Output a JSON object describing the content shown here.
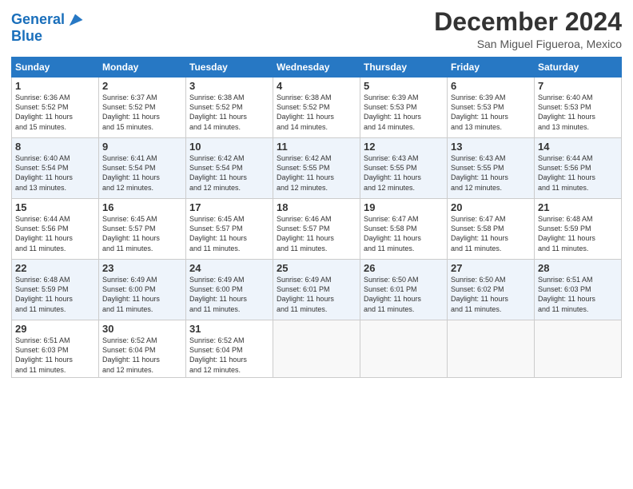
{
  "header": {
    "logo_line1": "General",
    "logo_line2": "Blue",
    "month": "December 2024",
    "location": "San Miguel Figueroa, Mexico"
  },
  "days_of_week": [
    "Sunday",
    "Monday",
    "Tuesday",
    "Wednesday",
    "Thursday",
    "Friday",
    "Saturday"
  ],
  "weeks": [
    [
      {
        "num": "1",
        "lines": [
          "Sunrise: 6:36 AM",
          "Sunset: 5:52 PM",
          "Daylight: 11 hours",
          "and 15 minutes."
        ]
      },
      {
        "num": "2",
        "lines": [
          "Sunrise: 6:37 AM",
          "Sunset: 5:52 PM",
          "Daylight: 11 hours",
          "and 15 minutes."
        ]
      },
      {
        "num": "3",
        "lines": [
          "Sunrise: 6:38 AM",
          "Sunset: 5:52 PM",
          "Daylight: 11 hours",
          "and 14 minutes."
        ]
      },
      {
        "num": "4",
        "lines": [
          "Sunrise: 6:38 AM",
          "Sunset: 5:52 PM",
          "Daylight: 11 hours",
          "and 14 minutes."
        ]
      },
      {
        "num": "5",
        "lines": [
          "Sunrise: 6:39 AM",
          "Sunset: 5:53 PM",
          "Daylight: 11 hours",
          "and 14 minutes."
        ]
      },
      {
        "num": "6",
        "lines": [
          "Sunrise: 6:39 AM",
          "Sunset: 5:53 PM",
          "Daylight: 11 hours",
          "and 13 minutes."
        ]
      },
      {
        "num": "7",
        "lines": [
          "Sunrise: 6:40 AM",
          "Sunset: 5:53 PM",
          "Daylight: 11 hours",
          "and 13 minutes."
        ]
      }
    ],
    [
      {
        "num": "8",
        "lines": [
          "Sunrise: 6:40 AM",
          "Sunset: 5:54 PM",
          "Daylight: 11 hours",
          "and 13 minutes."
        ]
      },
      {
        "num": "9",
        "lines": [
          "Sunrise: 6:41 AM",
          "Sunset: 5:54 PM",
          "Daylight: 11 hours",
          "and 12 minutes."
        ]
      },
      {
        "num": "10",
        "lines": [
          "Sunrise: 6:42 AM",
          "Sunset: 5:54 PM",
          "Daylight: 11 hours",
          "and 12 minutes."
        ]
      },
      {
        "num": "11",
        "lines": [
          "Sunrise: 6:42 AM",
          "Sunset: 5:55 PM",
          "Daylight: 11 hours",
          "and 12 minutes."
        ]
      },
      {
        "num": "12",
        "lines": [
          "Sunrise: 6:43 AM",
          "Sunset: 5:55 PM",
          "Daylight: 11 hours",
          "and 12 minutes."
        ]
      },
      {
        "num": "13",
        "lines": [
          "Sunrise: 6:43 AM",
          "Sunset: 5:55 PM",
          "Daylight: 11 hours",
          "and 12 minutes."
        ]
      },
      {
        "num": "14",
        "lines": [
          "Sunrise: 6:44 AM",
          "Sunset: 5:56 PM",
          "Daylight: 11 hours",
          "and 11 minutes."
        ]
      }
    ],
    [
      {
        "num": "15",
        "lines": [
          "Sunrise: 6:44 AM",
          "Sunset: 5:56 PM",
          "Daylight: 11 hours",
          "and 11 minutes."
        ]
      },
      {
        "num": "16",
        "lines": [
          "Sunrise: 6:45 AM",
          "Sunset: 5:57 PM",
          "Daylight: 11 hours",
          "and 11 minutes."
        ]
      },
      {
        "num": "17",
        "lines": [
          "Sunrise: 6:45 AM",
          "Sunset: 5:57 PM",
          "Daylight: 11 hours",
          "and 11 minutes."
        ]
      },
      {
        "num": "18",
        "lines": [
          "Sunrise: 6:46 AM",
          "Sunset: 5:57 PM",
          "Daylight: 11 hours",
          "and 11 minutes."
        ]
      },
      {
        "num": "19",
        "lines": [
          "Sunrise: 6:47 AM",
          "Sunset: 5:58 PM",
          "Daylight: 11 hours",
          "and 11 minutes."
        ]
      },
      {
        "num": "20",
        "lines": [
          "Sunrise: 6:47 AM",
          "Sunset: 5:58 PM",
          "Daylight: 11 hours",
          "and 11 minutes."
        ]
      },
      {
        "num": "21",
        "lines": [
          "Sunrise: 6:48 AM",
          "Sunset: 5:59 PM",
          "Daylight: 11 hours",
          "and 11 minutes."
        ]
      }
    ],
    [
      {
        "num": "22",
        "lines": [
          "Sunrise: 6:48 AM",
          "Sunset: 5:59 PM",
          "Daylight: 11 hours",
          "and 11 minutes."
        ]
      },
      {
        "num": "23",
        "lines": [
          "Sunrise: 6:49 AM",
          "Sunset: 6:00 PM",
          "Daylight: 11 hours",
          "and 11 minutes."
        ]
      },
      {
        "num": "24",
        "lines": [
          "Sunrise: 6:49 AM",
          "Sunset: 6:00 PM",
          "Daylight: 11 hours",
          "and 11 minutes."
        ]
      },
      {
        "num": "25",
        "lines": [
          "Sunrise: 6:49 AM",
          "Sunset: 6:01 PM",
          "Daylight: 11 hours",
          "and 11 minutes."
        ]
      },
      {
        "num": "26",
        "lines": [
          "Sunrise: 6:50 AM",
          "Sunset: 6:01 PM",
          "Daylight: 11 hours",
          "and 11 minutes."
        ]
      },
      {
        "num": "27",
        "lines": [
          "Sunrise: 6:50 AM",
          "Sunset: 6:02 PM",
          "Daylight: 11 hours",
          "and 11 minutes."
        ]
      },
      {
        "num": "28",
        "lines": [
          "Sunrise: 6:51 AM",
          "Sunset: 6:03 PM",
          "Daylight: 11 hours",
          "and 11 minutes."
        ]
      }
    ],
    [
      {
        "num": "29",
        "lines": [
          "Sunrise: 6:51 AM",
          "Sunset: 6:03 PM",
          "Daylight: 11 hours",
          "and 11 minutes."
        ]
      },
      {
        "num": "30",
        "lines": [
          "Sunrise: 6:52 AM",
          "Sunset: 6:04 PM",
          "Daylight: 11 hours",
          "and 12 minutes."
        ]
      },
      {
        "num": "31",
        "lines": [
          "Sunrise: 6:52 AM",
          "Sunset: 6:04 PM",
          "Daylight: 11 hours",
          "and 12 minutes."
        ]
      },
      null,
      null,
      null,
      null
    ]
  ]
}
